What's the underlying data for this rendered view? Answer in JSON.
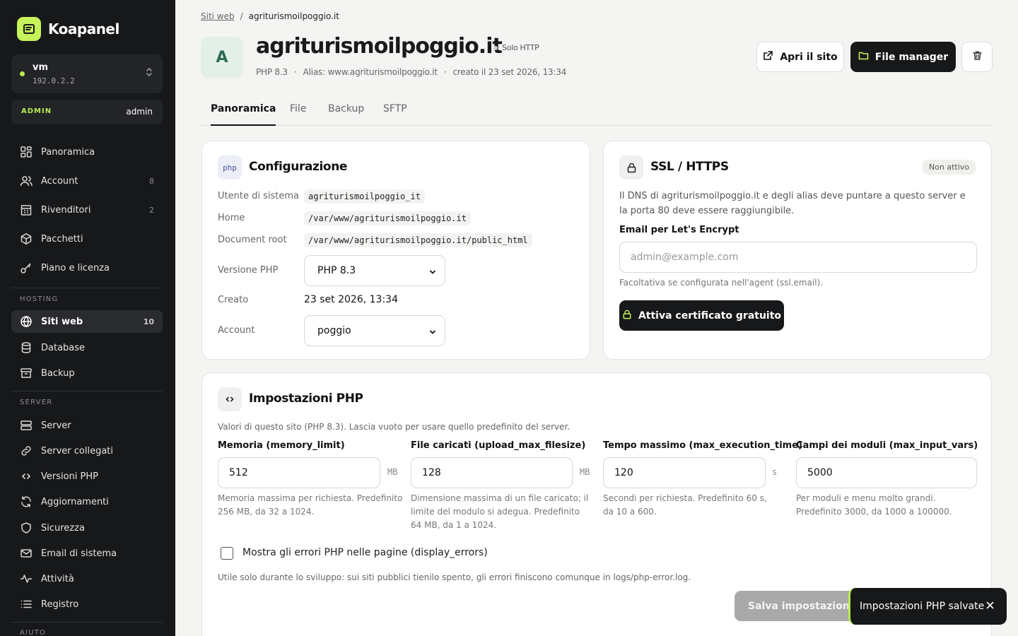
{
  "app": {
    "name": "Koapanel"
  },
  "server": {
    "name": "vm",
    "ip": "192.0.2.2"
  },
  "role": {
    "label": "ADMIN",
    "user": "admin"
  },
  "nav": {
    "main": [
      {
        "label": "Panoramica",
        "icon": "grid-icon"
      },
      {
        "label": "Account",
        "icon": "users-icon",
        "count": "8"
      },
      {
        "label": "Rivenditori",
        "icon": "building-icon",
        "count": "2"
      },
      {
        "label": "Pacchetti",
        "icon": "package-icon"
      },
      {
        "label": "Piano e licenza",
        "icon": "key-icon"
      }
    ],
    "hosting_label": "HOSTING",
    "hosting": [
      {
        "label": "Siti web",
        "icon": "globe-icon",
        "count": "10",
        "active": true
      },
      {
        "label": "Database",
        "icon": "database-icon"
      },
      {
        "label": "Backup",
        "icon": "archive-icon"
      }
    ],
    "server_label": "SERVER",
    "server": [
      {
        "label": "Server",
        "icon": "server-icon"
      },
      {
        "label": "Server collegati",
        "icon": "link-icon"
      },
      {
        "label": "Versioni PHP",
        "icon": "code-icon"
      },
      {
        "label": "Aggiornamenti",
        "icon": "refresh-icon"
      },
      {
        "label": "Sicurezza",
        "icon": "shield-icon"
      },
      {
        "label": "Email di sistema",
        "icon": "mail-icon"
      },
      {
        "label": "Attività",
        "icon": "activity-icon"
      },
      {
        "label": "Registro",
        "icon": "list-icon"
      }
    ],
    "next_label": "AIUTO"
  },
  "breadcrumb": {
    "parent": "Siti web",
    "separator": "/",
    "current": "agriturismoilpoggio.it"
  },
  "site": {
    "avatar": "A",
    "title": "agriturismoilpoggio.it",
    "badge": "Solo HTTP",
    "php": "PHP 8.3",
    "alias": "Alias: www.agriturismoilpoggio.it",
    "created": "creato il 23 set 2026, 13:34",
    "sep": "·"
  },
  "actions": {
    "open_site": "Apri il sito",
    "file_manager": "File manager"
  },
  "tabs": [
    "Panoramica",
    "File",
    "Backup",
    "SFTP"
  ],
  "config": {
    "icon_text": "php",
    "title": "Configurazione",
    "rows": {
      "user_label": "Utente di sistema",
      "user_value": "agriturismoilpoggio_it",
      "home_label": "Home",
      "home_value": "/var/www/agriturismoilpoggio.it",
      "docroot_label": "Document root",
      "docroot_value": "/var/www/agriturismoilpoggio.it/public_html",
      "php_label": "Versione PHP",
      "php_value": "PHP 8.3",
      "created_label": "Creato",
      "created_value": "23 set 2026, 13:34",
      "account_label": "Account",
      "account_value": "poggio"
    }
  },
  "ssl": {
    "title": "SSL / HTTPS",
    "status": "Non attivo",
    "description": "Il DNS di agriturismoilpoggio.it e degli alias deve puntare a questo server e la porta 80 deve essere raggiungibile.",
    "email_label": "Email per Let's Encrypt",
    "email_placeholder": "admin@example.com",
    "email_hint": "Facoltativa se configurata nell'agent (ssl.email).",
    "button": "Attiva certificato gratuito"
  },
  "php_settings": {
    "title": "Impostazioni PHP",
    "intro": "Valori di questo sito (PHP 8.3). Lascia vuoto per usare quello predefinito del server.",
    "fields": [
      {
        "label": "Memoria (memory_limit)",
        "value": "512",
        "unit": "MB",
        "hint": "Memoria massima per richiesta. Predefinito 256 MB, da 32 a 1024."
      },
      {
        "label": "File caricati (upload_max_filesize)",
        "value": "128",
        "unit": "MB",
        "hint": "Dimensione massima di un file caricato; il limite del modulo si adegua. Predefinito 64 MB, da 1 a 1024."
      },
      {
        "label": "Tempo massimo (max_execution_time)",
        "value": "120",
        "unit": "s",
        "hint": "Secondi per richiesta. Predefinito 60 s, da 10 a 600."
      },
      {
        "label": "Campi dei moduli (max_input_vars)",
        "value": "5000",
        "unit": "",
        "hint": "Per moduli e menu molto grandi. Predefinito 3000, da 1000 a 100000."
      }
    ],
    "display_errors_label": "Mostra gli errori PHP nelle pagine (display_errors)",
    "display_errors_checked": false,
    "display_errors_hint": "Utile solo durante lo sviluppo: sui siti pubblici tienilo spento, gli errori finiscono comunque in logs/php-error.log.",
    "save_button": "Salva impostazioni PHP"
  },
  "toast": {
    "message": "Impostazioni PHP salvate"
  },
  "colors": {
    "accent": "#c6f35a",
    "sidebar_bg": "#17181a",
    "page_bg": "#f4f4f2"
  }
}
